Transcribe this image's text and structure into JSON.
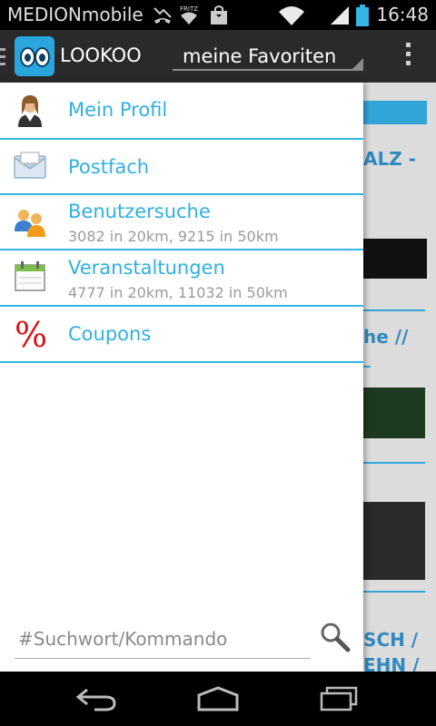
{
  "status_bar": {
    "carrier": "MEDIONmobile",
    "time": "16:48",
    "icons": [
      "missed-call-icon",
      "wifi-fritz-icon",
      "shopping-bag-icon",
      "wifi-icon",
      "signal-icon",
      "battery-icon"
    ]
  },
  "action_bar": {
    "app_name": "LOOKOO",
    "spinner_value": "meine Favoriten",
    "icons": [
      "app-logo-icon",
      "overflow-menu-icon"
    ]
  },
  "drawer": {
    "items": [
      {
        "label": "Mein Profil",
        "subtitle": "",
        "icon": "profile-person-icon"
      },
      {
        "label": "Postfach",
        "subtitle": "",
        "icon": "mail-envelope-icon"
      },
      {
        "label": "Benutzersuche",
        "subtitle": "3082 in 20km, 9215 in 50km",
        "icon": "users-group-icon"
      },
      {
        "label": "Veranstaltungen",
        "subtitle": "4777 in 20km, 11032 in 50km",
        "icon": "calendar-icon"
      },
      {
        "label": "Coupons",
        "subtitle": "",
        "icon": "percent-icon"
      }
    ],
    "accent_color": "#33b5e5"
  },
  "search": {
    "placeholder": "#Suchwort/Kommando",
    "value": ""
  },
  "background_content": {
    "snippets": [
      "ALZ -",
      "he //",
      "SCH /",
      "EHN /"
    ]
  },
  "nav_bar": {
    "buttons": [
      "back-icon",
      "home-icon",
      "recent-apps-icon"
    ]
  }
}
